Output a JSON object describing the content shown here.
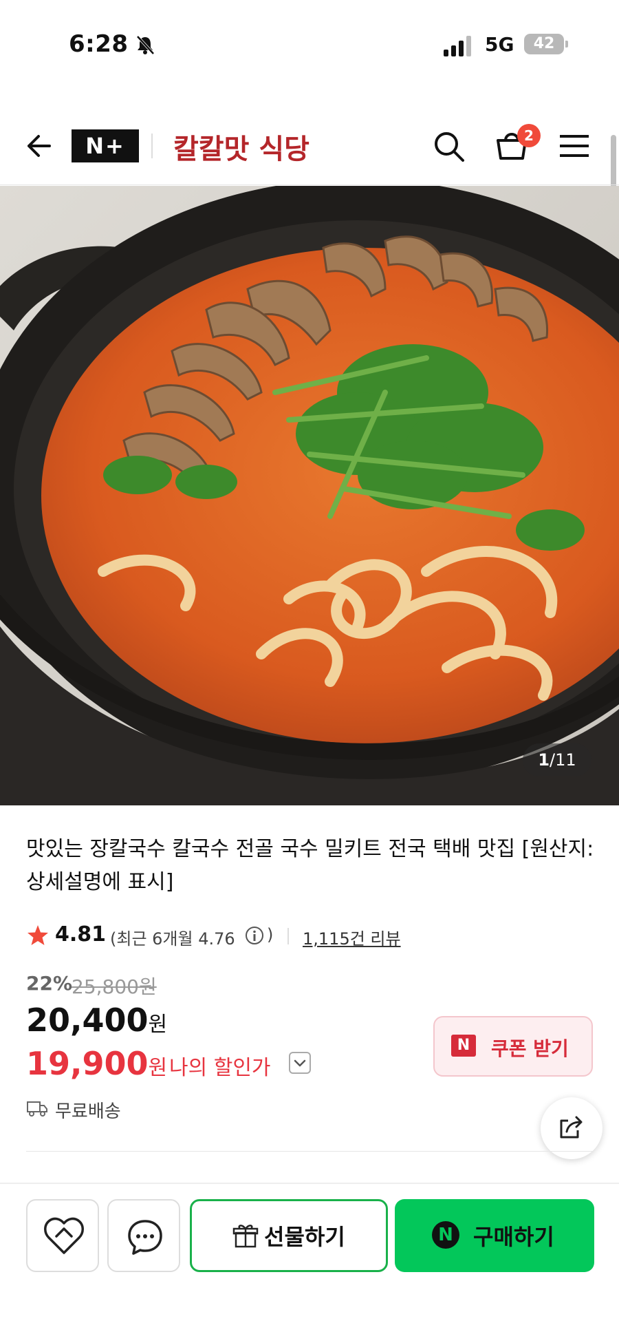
{
  "status_bar": {
    "time": "6:28",
    "network": "5G",
    "battery": "42"
  },
  "header": {
    "brand_badge": "N+",
    "store_name": "칼칼맛 식당",
    "cart_count": "2"
  },
  "gallery": {
    "current": "1",
    "total": "/11"
  },
  "product": {
    "title": "맛있는 장칼국수 칼국수 전골 국수 밀키트 전국 택배 맛집 [원산지:상세설명에 표시]",
    "rating": "4.81",
    "recent_rating_text": "(최근 6개월 4.76",
    "recent_rating_close": ")",
    "review_count": "1,115건 리뷰",
    "discount_rate": "22%",
    "original_price": "25,800원",
    "price": "20,400",
    "price_unit": "원",
    "my_price": "19,900",
    "my_price_unit": "원",
    "my_price_label": "나의 할인가",
    "coupon_badge": "N",
    "coupon_button": "쿠폰 받기",
    "shipping": "무료배송"
  },
  "bottom_bar": {
    "gift_label": "선물하기",
    "buy_badge": "N",
    "buy_label": "구매하기"
  },
  "colors": {
    "brand_red": "#b4262a",
    "sale_red": "#e7343f",
    "naver_green": "#03c75a"
  }
}
